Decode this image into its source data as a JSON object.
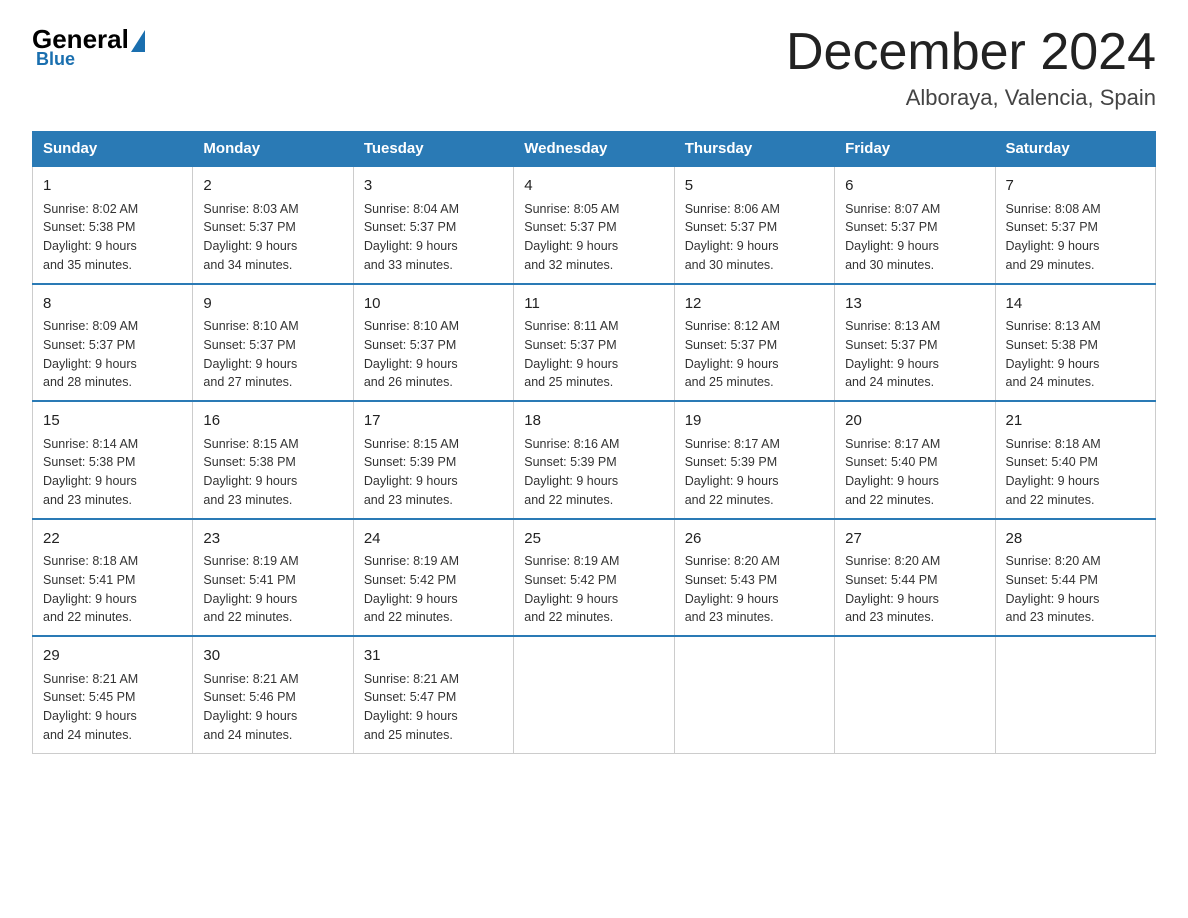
{
  "header": {
    "logo_general": "General",
    "logo_blue": "Blue",
    "title": "December 2024",
    "subtitle": "Alboraya, Valencia, Spain"
  },
  "days_of_week": [
    "Sunday",
    "Monday",
    "Tuesday",
    "Wednesday",
    "Thursday",
    "Friday",
    "Saturday"
  ],
  "weeks": [
    [
      {
        "day": "1",
        "sunrise": "8:02 AM",
        "sunset": "5:38 PM",
        "daylight": "9 hours and 35 minutes."
      },
      {
        "day": "2",
        "sunrise": "8:03 AM",
        "sunset": "5:37 PM",
        "daylight": "9 hours and 34 minutes."
      },
      {
        "day": "3",
        "sunrise": "8:04 AM",
        "sunset": "5:37 PM",
        "daylight": "9 hours and 33 minutes."
      },
      {
        "day": "4",
        "sunrise": "8:05 AM",
        "sunset": "5:37 PM",
        "daylight": "9 hours and 32 minutes."
      },
      {
        "day": "5",
        "sunrise": "8:06 AM",
        "sunset": "5:37 PM",
        "daylight": "9 hours and 30 minutes."
      },
      {
        "day": "6",
        "sunrise": "8:07 AM",
        "sunset": "5:37 PM",
        "daylight": "9 hours and 30 minutes."
      },
      {
        "day": "7",
        "sunrise": "8:08 AM",
        "sunset": "5:37 PM",
        "daylight": "9 hours and 29 minutes."
      }
    ],
    [
      {
        "day": "8",
        "sunrise": "8:09 AM",
        "sunset": "5:37 PM",
        "daylight": "9 hours and 28 minutes."
      },
      {
        "day": "9",
        "sunrise": "8:10 AM",
        "sunset": "5:37 PM",
        "daylight": "9 hours and 27 minutes."
      },
      {
        "day": "10",
        "sunrise": "8:10 AM",
        "sunset": "5:37 PM",
        "daylight": "9 hours and 26 minutes."
      },
      {
        "day": "11",
        "sunrise": "8:11 AM",
        "sunset": "5:37 PM",
        "daylight": "9 hours and 25 minutes."
      },
      {
        "day": "12",
        "sunrise": "8:12 AM",
        "sunset": "5:37 PM",
        "daylight": "9 hours and 25 minutes."
      },
      {
        "day": "13",
        "sunrise": "8:13 AM",
        "sunset": "5:37 PM",
        "daylight": "9 hours and 24 minutes."
      },
      {
        "day": "14",
        "sunrise": "8:13 AM",
        "sunset": "5:38 PM",
        "daylight": "9 hours and 24 minutes."
      }
    ],
    [
      {
        "day": "15",
        "sunrise": "8:14 AM",
        "sunset": "5:38 PM",
        "daylight": "9 hours and 23 minutes."
      },
      {
        "day": "16",
        "sunrise": "8:15 AM",
        "sunset": "5:38 PM",
        "daylight": "9 hours and 23 minutes."
      },
      {
        "day": "17",
        "sunrise": "8:15 AM",
        "sunset": "5:39 PM",
        "daylight": "9 hours and 23 minutes."
      },
      {
        "day": "18",
        "sunrise": "8:16 AM",
        "sunset": "5:39 PM",
        "daylight": "9 hours and 22 minutes."
      },
      {
        "day": "19",
        "sunrise": "8:17 AM",
        "sunset": "5:39 PM",
        "daylight": "9 hours and 22 minutes."
      },
      {
        "day": "20",
        "sunrise": "8:17 AM",
        "sunset": "5:40 PM",
        "daylight": "9 hours and 22 minutes."
      },
      {
        "day": "21",
        "sunrise": "8:18 AM",
        "sunset": "5:40 PM",
        "daylight": "9 hours and 22 minutes."
      }
    ],
    [
      {
        "day": "22",
        "sunrise": "8:18 AM",
        "sunset": "5:41 PM",
        "daylight": "9 hours and 22 minutes."
      },
      {
        "day": "23",
        "sunrise": "8:19 AM",
        "sunset": "5:41 PM",
        "daylight": "9 hours and 22 minutes."
      },
      {
        "day": "24",
        "sunrise": "8:19 AM",
        "sunset": "5:42 PM",
        "daylight": "9 hours and 22 minutes."
      },
      {
        "day": "25",
        "sunrise": "8:19 AM",
        "sunset": "5:42 PM",
        "daylight": "9 hours and 22 minutes."
      },
      {
        "day": "26",
        "sunrise": "8:20 AM",
        "sunset": "5:43 PM",
        "daylight": "9 hours and 23 minutes."
      },
      {
        "day": "27",
        "sunrise": "8:20 AM",
        "sunset": "5:44 PM",
        "daylight": "9 hours and 23 minutes."
      },
      {
        "day": "28",
        "sunrise": "8:20 AM",
        "sunset": "5:44 PM",
        "daylight": "9 hours and 23 minutes."
      }
    ],
    [
      {
        "day": "29",
        "sunrise": "8:21 AM",
        "sunset": "5:45 PM",
        "daylight": "9 hours and 24 minutes."
      },
      {
        "day": "30",
        "sunrise": "8:21 AM",
        "sunset": "5:46 PM",
        "daylight": "9 hours and 24 minutes."
      },
      {
        "day": "31",
        "sunrise": "8:21 AM",
        "sunset": "5:47 PM",
        "daylight": "9 hours and 25 minutes."
      },
      null,
      null,
      null,
      null
    ]
  ],
  "labels": {
    "sunrise": "Sunrise:",
    "sunset": "Sunset:",
    "daylight": "Daylight:"
  }
}
